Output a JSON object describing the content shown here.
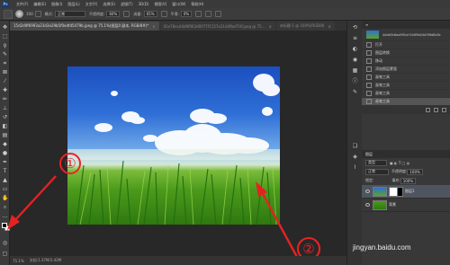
{
  "menubar": {
    "logo": "Ps",
    "items": [
      "文件(F)",
      "编辑(E)",
      "图像(I)",
      "图层(L)",
      "文字(Y)",
      "选择(S)",
      "滤镜(T)",
      "3D(D)",
      "视图(V)",
      "窗口(W)",
      "帮助(H)"
    ]
  },
  "options": {
    "brush_size": "100",
    "mode_label": "模式:",
    "mode_value": "正常",
    "opacity_label": "不透明度:",
    "opacity_value": "60%",
    "flow_label": "流量:",
    "flow_value": "65%",
    "smooth_label": "平滑:",
    "smooth_value": "0%"
  },
  "tabs": [
    {
      "label": "15d2d9f6993a23d3e29b5f0edfd5479b.jpeg @ 75.1%(图层0 副本, RGB/8#)*",
      "active": true
    },
    {
      "label": "01e78ecd4d9f063d0077f1157e21d4fbef74f.jpeg @ 75...",
      "active": false
    },
    {
      "label": "未标题-1 @ 100%(RGB/8)",
      "active": false
    }
  ],
  "status": {
    "zoom": "75.1%",
    "doc": "文档:1.37M/3.42M"
  },
  "history": {
    "items": [
      {
        "label": "4ddd3c6aa9f5ce7d4f9b04d3f9d8d3c",
        "snapshot": true
      },
      {
        "label": "打开"
      },
      {
        "label": "图层转换"
      },
      {
        "label": "移动"
      },
      {
        "label": "添加图层蒙版"
      },
      {
        "label": "画笔工具"
      },
      {
        "label": "画笔工具"
      },
      {
        "label": "画笔工具"
      },
      {
        "label": "画笔工具"
      }
    ]
  },
  "layers": {
    "header": "图层",
    "kind": "类型",
    "blend": "正常",
    "opacity_label": "不透明度:",
    "opacity_value": "100%",
    "lock_label": "锁定:",
    "fill_label": "填充:",
    "fill_value": "100%",
    "rows": [
      {
        "label": "图层1",
        "active": true
      },
      {
        "label": "背景",
        "active": false
      }
    ]
  },
  "annotations": {
    "one": "①",
    "two": "②"
  },
  "watermark": "jingyan.baidu.com",
  "colors": {
    "foreground": "#000000",
    "background": "#ffffff",
    "arrow": "#e52222"
  }
}
